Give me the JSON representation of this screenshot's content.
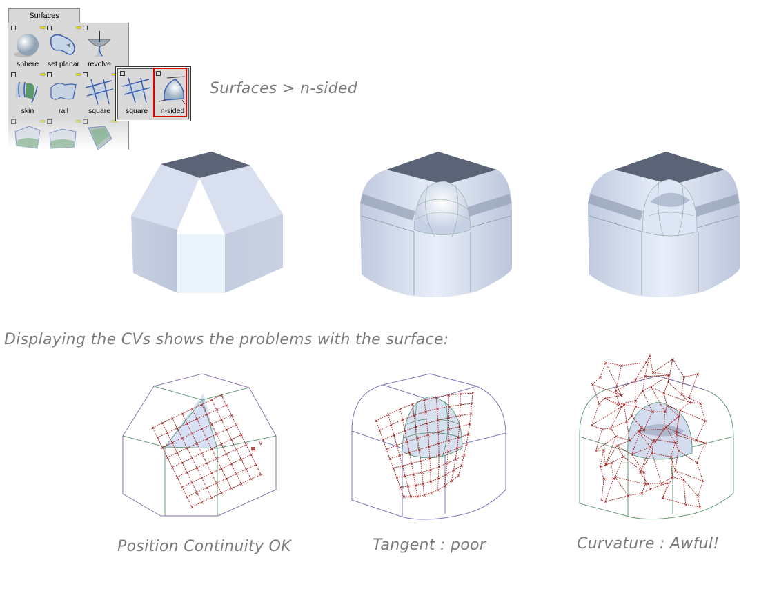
{
  "shelf": {
    "tab_label": "Surfaces",
    "tools": [
      {
        "label": "sphere",
        "icon": "sphere-icon"
      },
      {
        "label": "set planar",
        "icon": "set-planar-icon"
      },
      {
        "label": "revolve",
        "icon": "revolve-icon"
      },
      {
        "label": "skin",
        "icon": "skin-icon"
      },
      {
        "label": "rail",
        "icon": "rail-icon"
      },
      {
        "label": "square",
        "icon": "square-icon"
      }
    ],
    "popup": {
      "tools": [
        {
          "label": "square",
          "icon": "square-icon"
        },
        {
          "label": "n-sided",
          "icon": "n-sided-icon",
          "selected": true
        }
      ],
      "highlight_color": "#e00000"
    }
  },
  "menu_path": "Surfaces > n-sided",
  "section_caption": "Displaying the CVs shows the problems with the surface:",
  "captions": [
    "Position Continuity OK",
    "Tangent : poor",
    "Curvature : Awful!"
  ],
  "colors": {
    "cv_hull": "#a02020",
    "surface_blue": "#c8d4ea",
    "top_face": "#5b6476",
    "edge_green": "#6a9a7a",
    "edge_purple": "#8a70a8",
    "caption_gray": "#7a7a7a"
  }
}
